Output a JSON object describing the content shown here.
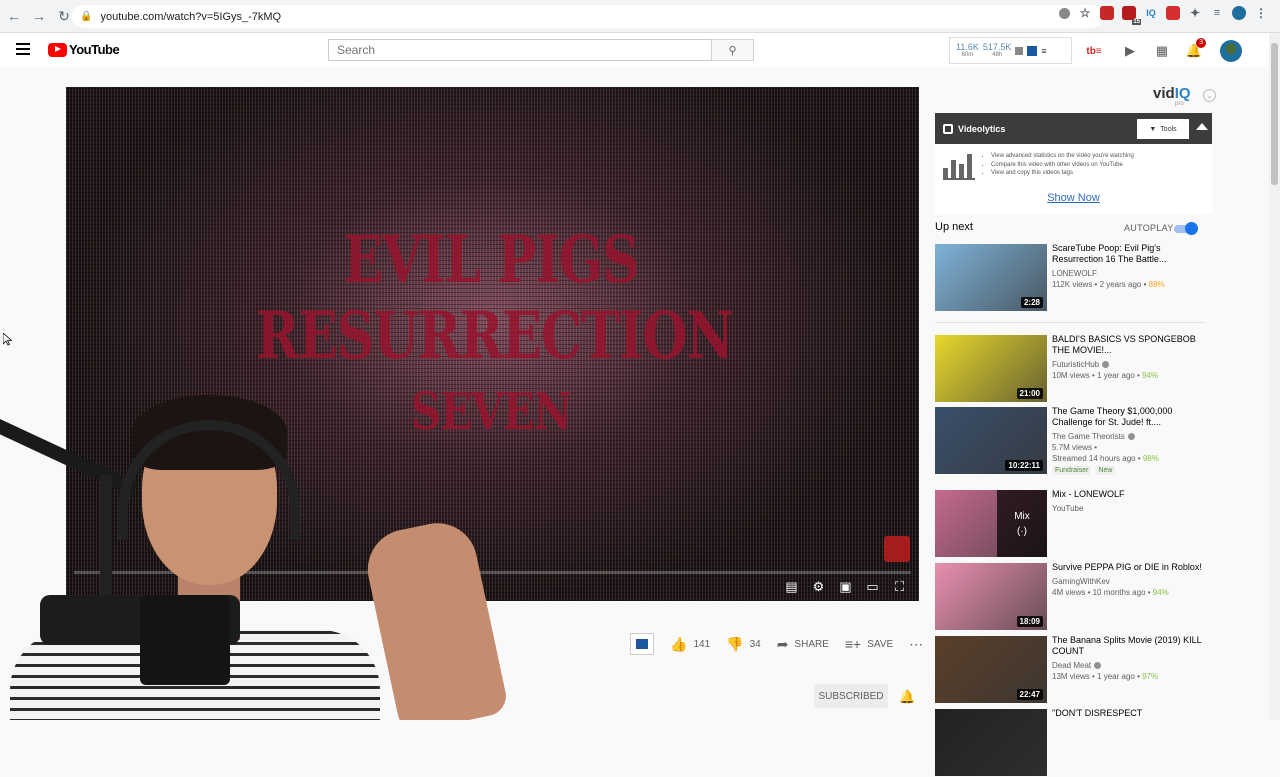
{
  "browser": {
    "url": "youtube.com/watch?v=5IGys_-7kMQ",
    "ext_badge": "15"
  },
  "header": {
    "logo_text": "YouTube",
    "search_placeholder": "Search",
    "stats": [
      {
        "value": "11.6K",
        "label": "60m"
      },
      {
        "value": "517.5K",
        "label": "48h"
      }
    ],
    "notification_count": "3"
  },
  "video": {
    "title_line1": "EVIL PIGS RESURRECTION",
    "title_line2": "SEVEN",
    "progress": 0.0
  },
  "actions": {
    "likes": "141",
    "dislikes": "34",
    "share_label": "SHARE",
    "save_label": "SAVE",
    "more_label": "⋯",
    "subscribed_label": "SUBSCRIBED"
  },
  "vidiq": {
    "brand_vid": "vid",
    "brand_iq": "IQ",
    "brand_pro": "pro",
    "panel_title": "Videolytics",
    "tools_label": "Tools",
    "bullets": [
      "View advanced statistics on the video you're watching",
      "Compare this video with other videos on YouTube",
      "View and copy this videos tags"
    ],
    "show_now": "Show Now"
  },
  "sidebar": {
    "up_next": "Up next",
    "autoplay": "AUTOPLAY",
    "autoplay_on": true,
    "items": [
      {
        "title": "ScareTube Poop: Evil Pig's Resurrection 16 The Battle...",
        "channel": "LONEWOLF",
        "views": "112K views • 2 years ago • ",
        "pct": "88%",
        "duration": "2:28",
        "thumb_color": "#7fb3d9"
      },
      {
        "title": "BALDI'S BASICS VS SPONGEBOB THE MOVIE!...",
        "channel": "FuturisticHub",
        "views": "10M views • 1 year ago • ",
        "pct": "94%",
        "duration": "21:00",
        "thumb_color": "#e8d82c"
      },
      {
        "title": "The Game Theory $1,000,000 Challenge for St. Jude! ft....",
        "channel": "The Game Theorists",
        "views": "5.7M views •",
        "views2": "Streamed 14 hours ago • ",
        "pct": "98%",
        "duration": "10:22:11",
        "badges": [
          "Fundraiser",
          "New"
        ],
        "thumb_color": "#3a4f6b"
      },
      {
        "title": "Mix - LONEWOLF",
        "channel": "YouTube",
        "overlay": "Mix",
        "thumb_color": "#c56a8e"
      },
      {
        "title": "Survive PEPPA PIG or DIE in Roblox!",
        "channel": "GamingWithKev",
        "views": "4M views • 10 months ago • ",
        "pct": "94%",
        "duration": "18:09",
        "thumb_color": "#e98fb0"
      },
      {
        "title": "The Banana Splits Movie (2019) KILL COUNT",
        "channel": "Dead Meat",
        "views": "13M views • 1 year ago • ",
        "pct": "97%",
        "duration": "22:47",
        "thumb_color": "#5a3f2a"
      },
      {
        "title": "\"DON'T DISRESPECT",
        "channel": "",
        "thumb_color": "#222"
      }
    ]
  }
}
